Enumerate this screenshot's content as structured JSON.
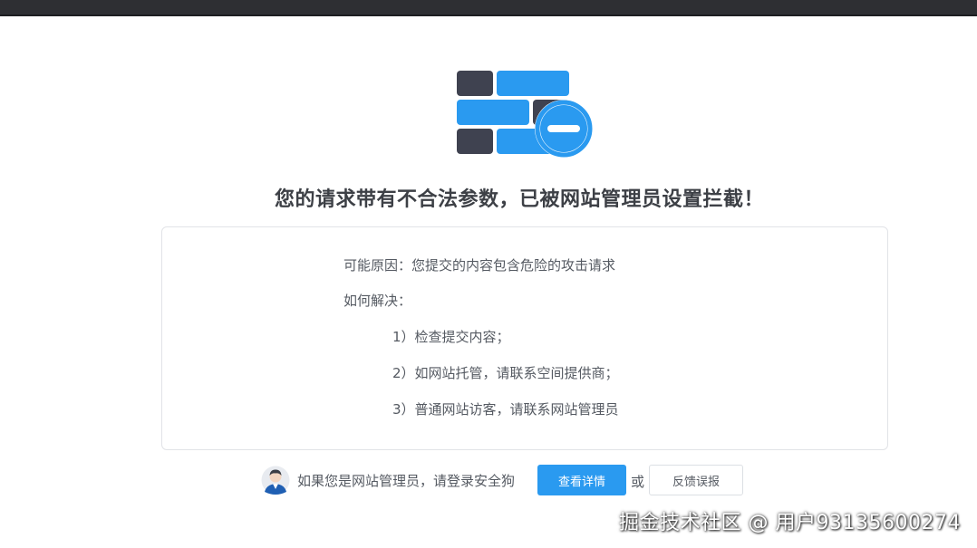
{
  "headline": "您的请求带有不合法参数，已被网站管理员设置拦截！",
  "reason_box": {
    "reason_line": "可能原因：您提交的内容包含危险的攻击请求",
    "solution_title": "如何解决：",
    "steps": [
      "1）检查提交内容；",
      "2）如网站托管，请联系空间提供商；",
      "3）普通网站访客，请联系网站管理员"
    ]
  },
  "footer": {
    "admin_text": "如果您是网站管理员，请登录安全狗",
    "view_details_label": "查看详情",
    "or_text": "或",
    "report_label": "反馈误报"
  },
  "watermark": "掘金技术社区 @ 用户93135600274",
  "colors": {
    "accent": "#2a9af0",
    "brick_dark": "#3f4250",
    "brick_blue": "#2a9af0",
    "text": "#555a62"
  },
  "icons": {
    "shield": "brick-wall-blocked-icon",
    "avatar": "admin-avatar-icon"
  }
}
